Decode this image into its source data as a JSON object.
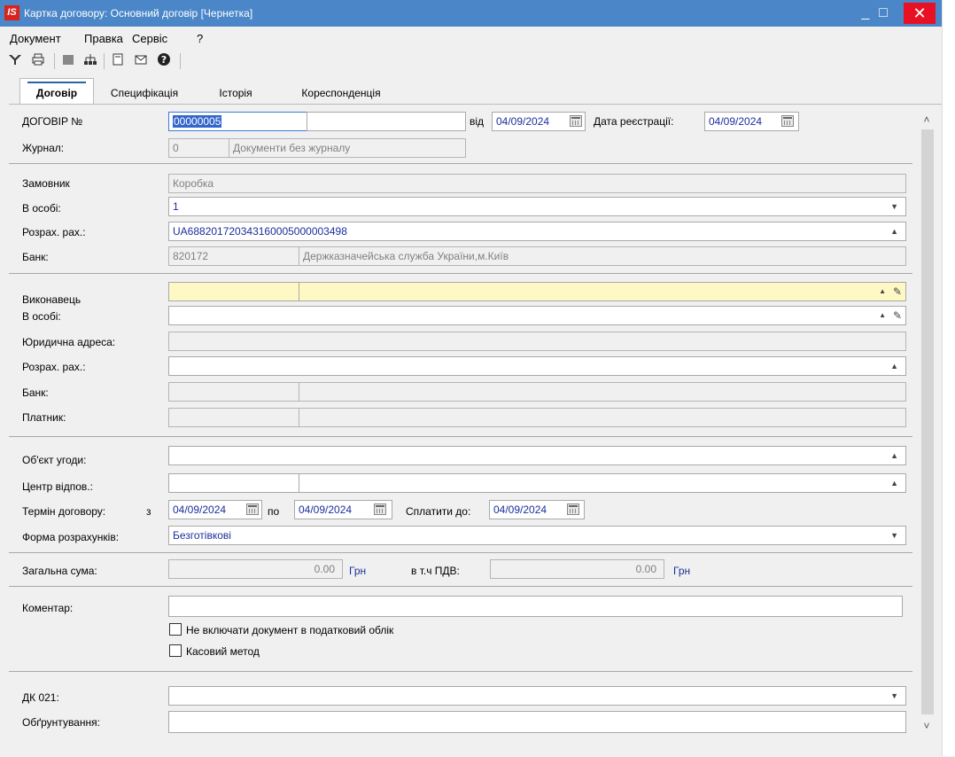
{
  "window": {
    "logo": "IS",
    "title": "Картка договору: Основний договір [Чернетка]",
    "minimize_glyph": "_",
    "maximize_glyph": "□",
    "close_glyph": "✕"
  },
  "menu": [
    "Документ",
    "Правка",
    "Сервіс",
    "?"
  ],
  "toolbar_icons": [
    "filter-icon",
    "print-icon",
    "block-icon",
    "tree-icon",
    "document-icon",
    "mail-icon",
    "help-icon"
  ],
  "tabs": [
    "Договір",
    "Специфікація",
    "Історія",
    "Кореспонденція"
  ],
  "form": {
    "contract_no_label": "ДОГОВІР №",
    "contract_no_value": "00000005",
    "contract_no_suffix": "",
    "date_from_label": "від",
    "date_from_value": "04/09/2024",
    "reg_date_label": "Дата реєстрації:",
    "reg_date_value": "04/09/2024",
    "journal_label": "Журнал:",
    "journal_code": "0",
    "journal_name": "Документи без журналу",
    "customer_label": "Замовник",
    "customer_value": "Коробка",
    "customer_person_label": "В особі:",
    "customer_person_value": "1",
    "customer_account_label": "Розрах. рах.:",
    "customer_account_value": "UA688201720343160005000003498",
    "customer_bank_label": "Банк:",
    "customer_bank_code": "820172",
    "customer_bank_name": "Держказначейська служба України,м.Київ",
    "executor_label": "Виконавець",
    "executor_person_label": "В особі:",
    "executor_address_label": "Юридична адреса:",
    "executor_account_label": "Розрах. рах.:",
    "executor_bank_label": "Банк:",
    "payer_label": "Платник:",
    "object_label": "Об'єкт угоди:",
    "center_label": "Центр відпов.:",
    "term_label": "Термін договору:",
    "term_from_label": "з",
    "term_from_value": "04/09/2024",
    "term_to_label": "по",
    "term_to_value": "04/09/2024",
    "pay_until_label": "Сплатити до:",
    "pay_until_value": "04/09/2024",
    "payment_form_label": "Форма розрахунків:",
    "payment_form_value": "Безготівкові",
    "total_label": "Загальна сума:",
    "total_value": "0.00",
    "total_unit": "Грн",
    "vat_label": "в т.ч ПДВ:",
    "vat_value": "0.00",
    "vat_unit": "Грн",
    "comment_label": "Коментар:",
    "chk_tax_label": "Не включати документ в податковий облік",
    "chk_cash_label": "Касовий метод",
    "dk_label": "ДК 021:",
    "reason_label": "Обґрунтування:"
  }
}
